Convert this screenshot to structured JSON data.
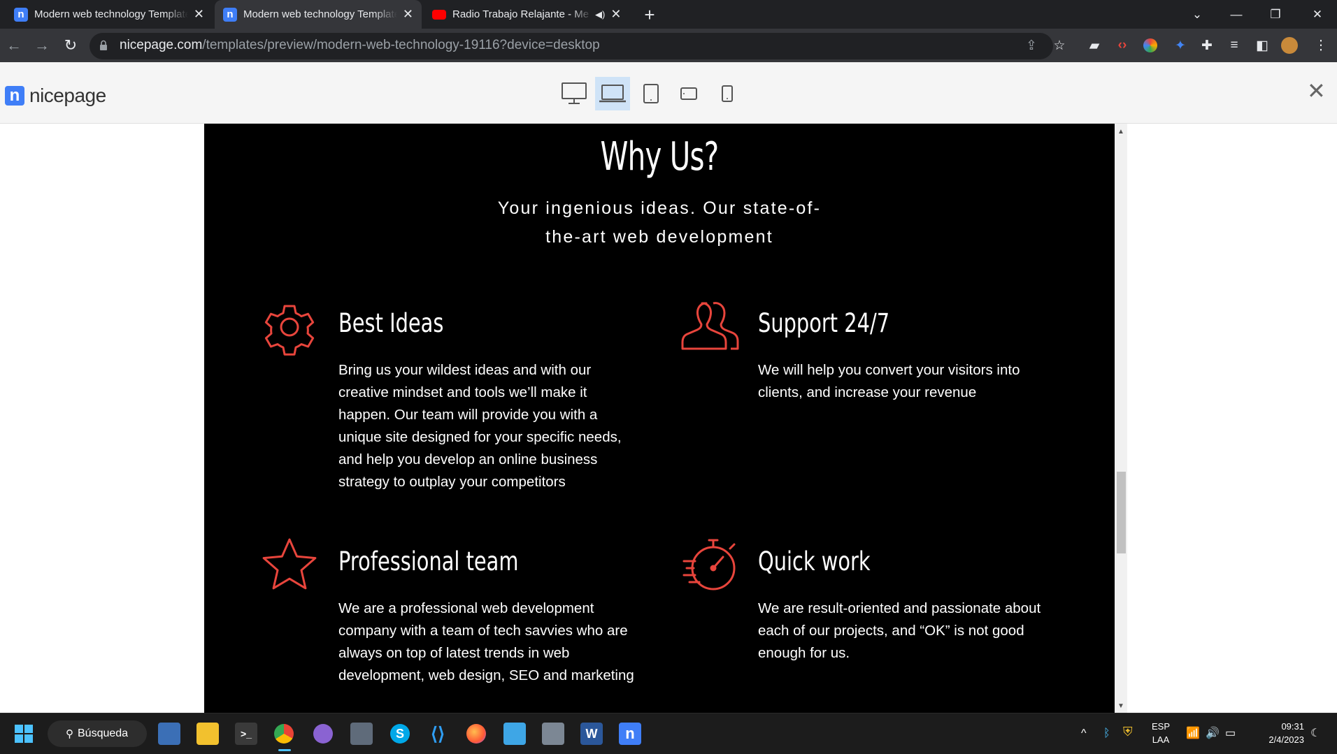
{
  "browser": {
    "tabs": [
      {
        "title": "Modern web technology Template",
        "favicon": "nicepage-icon"
      },
      {
        "title": "Modern web technology Template",
        "favicon": "nicepage-icon"
      },
      {
        "title": "Radio Trabajo Relajante - Me",
        "favicon": "youtube-icon"
      }
    ],
    "url_host": "nicepage.com",
    "url_path": "/templates/preview/modern-web-technology-19116?device=desktop"
  },
  "nicepage": {
    "logo_text": "nicepage",
    "devices": [
      "desktop-icon",
      "laptop-icon",
      "tablet-icon",
      "tablet-landscape-icon",
      "phone-icon"
    ],
    "active_device": "laptop-icon"
  },
  "site": {
    "heading": "Why Us?",
    "subtitle_line1": "Your ingenious ideas. Our state-of-",
    "subtitle_line2": "the-art web development",
    "accent_color": "#e8453c",
    "features": [
      {
        "title": "Best Ideas",
        "icon": "gear-icon",
        "text": "Bring us your wildest ideas and with our creative mindset and tools we’ll make it happen. Our team will provide you with a unique site designed for your specific needs, and help you develop an online business strategy to outplay your competitors"
      },
      {
        "title": "Support 24/7",
        "icon": "users-icon",
        "text": "We will help you convert your visitors into clients, and increase your revenue"
      },
      {
        "title": "Professional team",
        "icon": "star-icon",
        "text": "We are a professional web development company with a team of tech savvies who are always on top of latest trends in web development, web design, SEO and marketing"
      },
      {
        "title": "Quick work",
        "icon": "stopwatch-icon",
        "text": "We are result-oriented and passionate about each of our projects, and “OK” is not good enough for us."
      }
    ]
  },
  "taskbar": {
    "search_label": "Búsqueda",
    "lang_line1": "ESP",
    "lang_line2": "LAA",
    "time": "09:31",
    "date": "2/4/2023"
  }
}
